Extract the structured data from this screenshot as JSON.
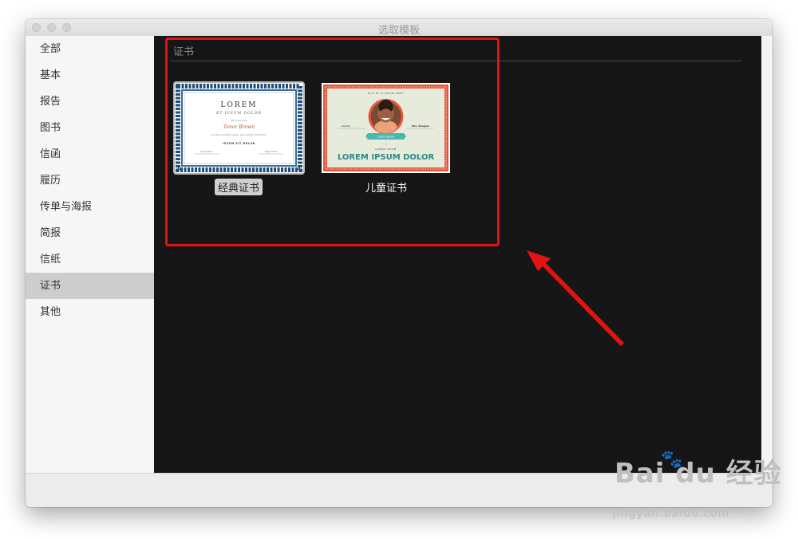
{
  "window": {
    "title": "选取模板"
  },
  "sidebar": {
    "items": [
      {
        "label": "全部"
      },
      {
        "label": "基本"
      },
      {
        "label": "报告"
      },
      {
        "label": "图书"
      },
      {
        "label": "信函"
      },
      {
        "label": "履历"
      },
      {
        "label": "传单与海报"
      },
      {
        "label": "简报"
      },
      {
        "label": "信纸"
      },
      {
        "label": "证书",
        "selected": true
      },
      {
        "label": "其他"
      }
    ]
  },
  "main": {
    "section_title": "证书",
    "templates": [
      {
        "caption": "经典证书",
        "selected": true,
        "preview": {
          "heading": "LOREM",
          "subheading": "ET IPSUM DOLOR",
          "line1": "Sit amet quis",
          "name": "Tenor Brown",
          "line2": "Ut enim ad minim veniam, quis nostrud exercitation",
          "footer": "IPSUM SIT DOLOR",
          "left_sign": "Sign Here",
          "right_sign": "Sign Here",
          "border_color": "#1f4f7a"
        }
      },
      {
        "caption": "儿童证书",
        "selected": false,
        "preview": {
          "top_text": "ELIT ET IS IPSUM AMET",
          "left_name": "Celeste",
          "right_name": "Mrs. Douglas",
          "ribbon": "Lorem Ipsum",
          "sub": "LOREM IPSUM",
          "big": "LOREM IPSUM DOLOR",
          "frame_color": "#e2583e",
          "big_color": "#2a8a86"
        }
      }
    ]
  },
  "watermark": {
    "logo": "Bai  du 经验",
    "url": "jingyan.baidu.com"
  }
}
